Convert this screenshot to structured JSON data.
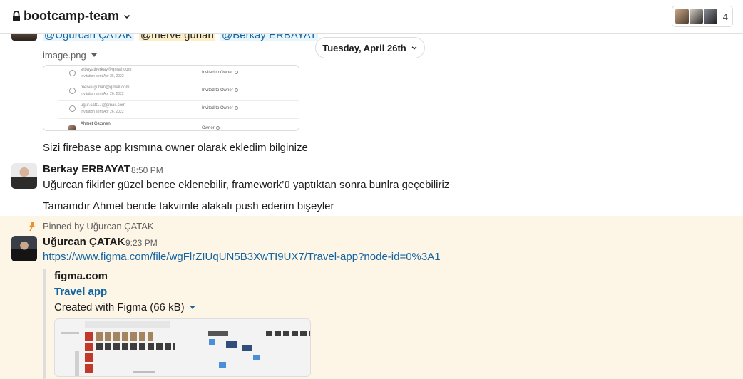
{
  "header": {
    "channel_name": "bootcamp-team",
    "member_count": "4"
  },
  "message_prev": {
    "mentions": [
      "@Uğurcan ÇATAK",
      "@merve guhan",
      "@Berkay ERBAYAT"
    ],
    "file_name": "image.png",
    "image_preview": {
      "rows": [
        {
          "email": "erbayatberkay@gmail.com",
          "sent": "Invitation sent Apr 26, 2022",
          "role": "Invited to Owner"
        },
        {
          "email": "merve.guhan@gmail.com",
          "sent": "Invitation sent Apr 26, 2022",
          "role": "Invited to Owner"
        },
        {
          "email": "ugur.catt17@gmail.com",
          "sent": "Invitation sent Apr 26, 2022",
          "role": "Invited to Owner"
        },
        {
          "email": "Ahmet Gezmen",
          "sent": "",
          "role": "Owner"
        }
      ]
    },
    "text": "Sizi firebase app kısmına owner olarak ekledim bilginize"
  },
  "date_divider": "Tuesday, April 26th",
  "message_berkay": {
    "author": "Berkay ERBAYAT",
    "time": "8:50 PM",
    "text1": "Uğurcan fikirler güzel bence eklenebilir, framework’ü yaptıktan sonra bunlra geçebiliriz",
    "text2": "Tamamdır Ahmet bende takvimle alakalı push ederim bişeyler"
  },
  "message_pinned": {
    "pinned_by": "Pinned by Uğurcan ÇATAK",
    "author": "Uğurcan ÇATAK",
    "time": "9:23 PM",
    "link": "https://www.figma.com/file/wgFlrZIUqUN5B3XwTI9UX7/Travel-app?node-id=0%3A1",
    "unfurl": {
      "site": "figma.com",
      "title": "Travel app",
      "description": "Created with Figma (66 kB)"
    }
  },
  "colors": {
    "link": "#1264a3",
    "pinned_background": "#fdf5e6",
    "mention_background": "#e8f5fa",
    "self_mention_background": "#fcefc7"
  }
}
